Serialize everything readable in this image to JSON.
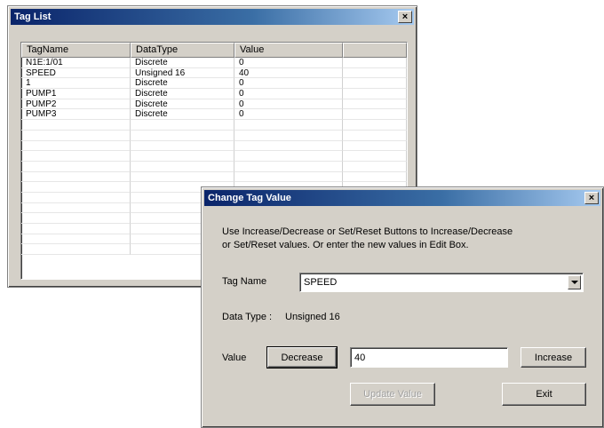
{
  "tag_list": {
    "title": "Tag List",
    "close": "×",
    "columns": [
      "TagName",
      "DataType",
      "Value",
      ""
    ],
    "rows": [
      [
        "N1E:1/01",
        "Discrete",
        "0",
        ""
      ],
      [
        "SPEED",
        "Unsigned 16",
        "40",
        ""
      ],
      [
        "1",
        "Discrete",
        "0",
        ""
      ],
      [
        "PUMP1",
        "Discrete",
        "0",
        ""
      ],
      [
        "PUMP2",
        "Discrete",
        "0",
        ""
      ],
      [
        "PUMP3",
        "Discrete",
        "0",
        ""
      ]
    ],
    "empty_rows": 13
  },
  "dialog": {
    "title": "Change Tag Value",
    "close": "×",
    "instructions_1": "Use Increase/Decrease or Set/Reset Buttons to Increase/Decrease",
    "instructions_2": "or Set/Reset values. Or enter the new values in Edit Box.",
    "tag_name_label": "Tag Name",
    "tag_name_value": "SPEED",
    "data_type_label": "Data Type :",
    "data_type_value": "Unsigned 16",
    "value_label": "Value",
    "decrease_label": "Decrease",
    "value_input": "40",
    "increase_label": "Increase",
    "update_label": "Update Value",
    "exit_label": "Exit"
  }
}
